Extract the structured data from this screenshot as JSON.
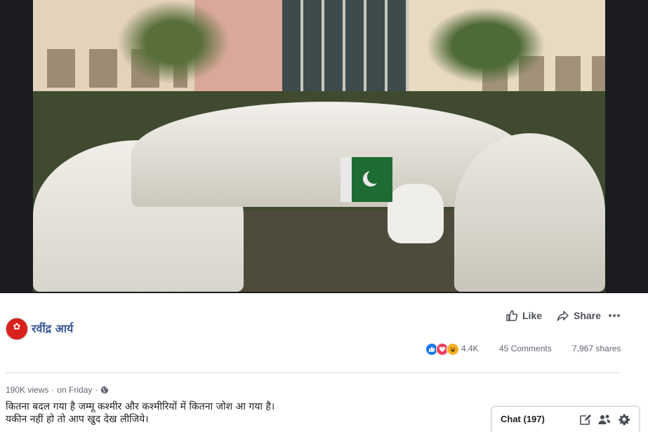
{
  "post": {
    "page_name": "रवींद्र आर्य",
    "views": "190K views",
    "time": "on Friday",
    "caption_line1": "कितना बदल गया है जम्मू कश्मीर और कश्मीरियों में कितना जोश आ गया है।",
    "caption_line2": "यकीन नहीं हो तो आप खुद देख लीजिये।"
  },
  "actions": {
    "like_label": "Like",
    "share_label": "Share"
  },
  "stats": {
    "reactions_count": "4.4K",
    "comments": "45 Comments",
    "shares": "7,967 shares"
  },
  "chat": {
    "label": "Chat (197)"
  },
  "icons": {
    "like": "thumbs-up-icon",
    "share": "share-arrow-icon",
    "more": "more-dots-icon",
    "globe": "globe-icon",
    "compose": "compose-icon",
    "contacts": "contacts-icon",
    "settings": "gear-icon"
  },
  "colors": {
    "link_blue": "#385898",
    "text_gray": "#616770",
    "like_blue": "#1877f2",
    "love_red": "#f33e58",
    "haha_yellow": "#f7b125"
  }
}
